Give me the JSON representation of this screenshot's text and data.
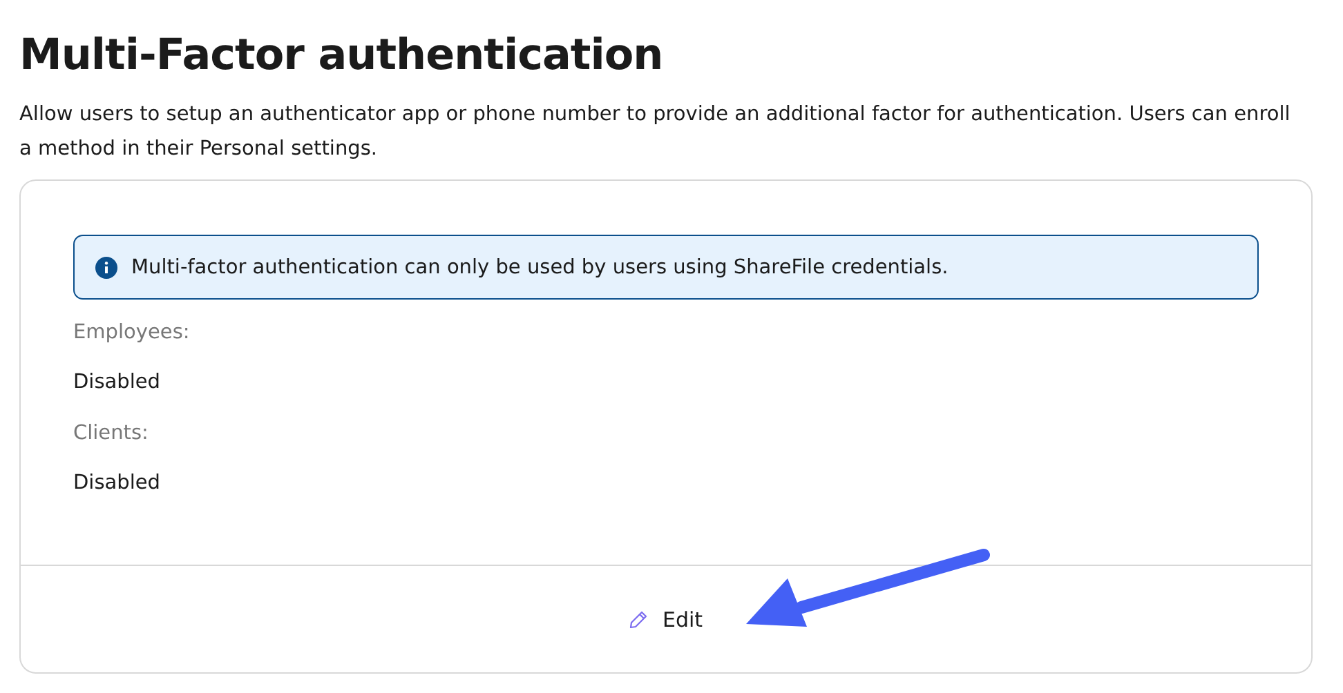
{
  "title": "Multi-Factor authentication",
  "description": "Allow users to setup an authenticator app or phone number to provide an additional factor for authentication. Users can enroll a method in their Personal settings.",
  "card": {
    "notice": "Multi-factor authentication can only be used by users using ShareFile credentials.",
    "settings": [
      {
        "label": "Employees:",
        "value": "Disabled"
      },
      {
        "label": "Clients:",
        "value": "Disabled"
      }
    ],
    "edit_button": "Edit"
  }
}
